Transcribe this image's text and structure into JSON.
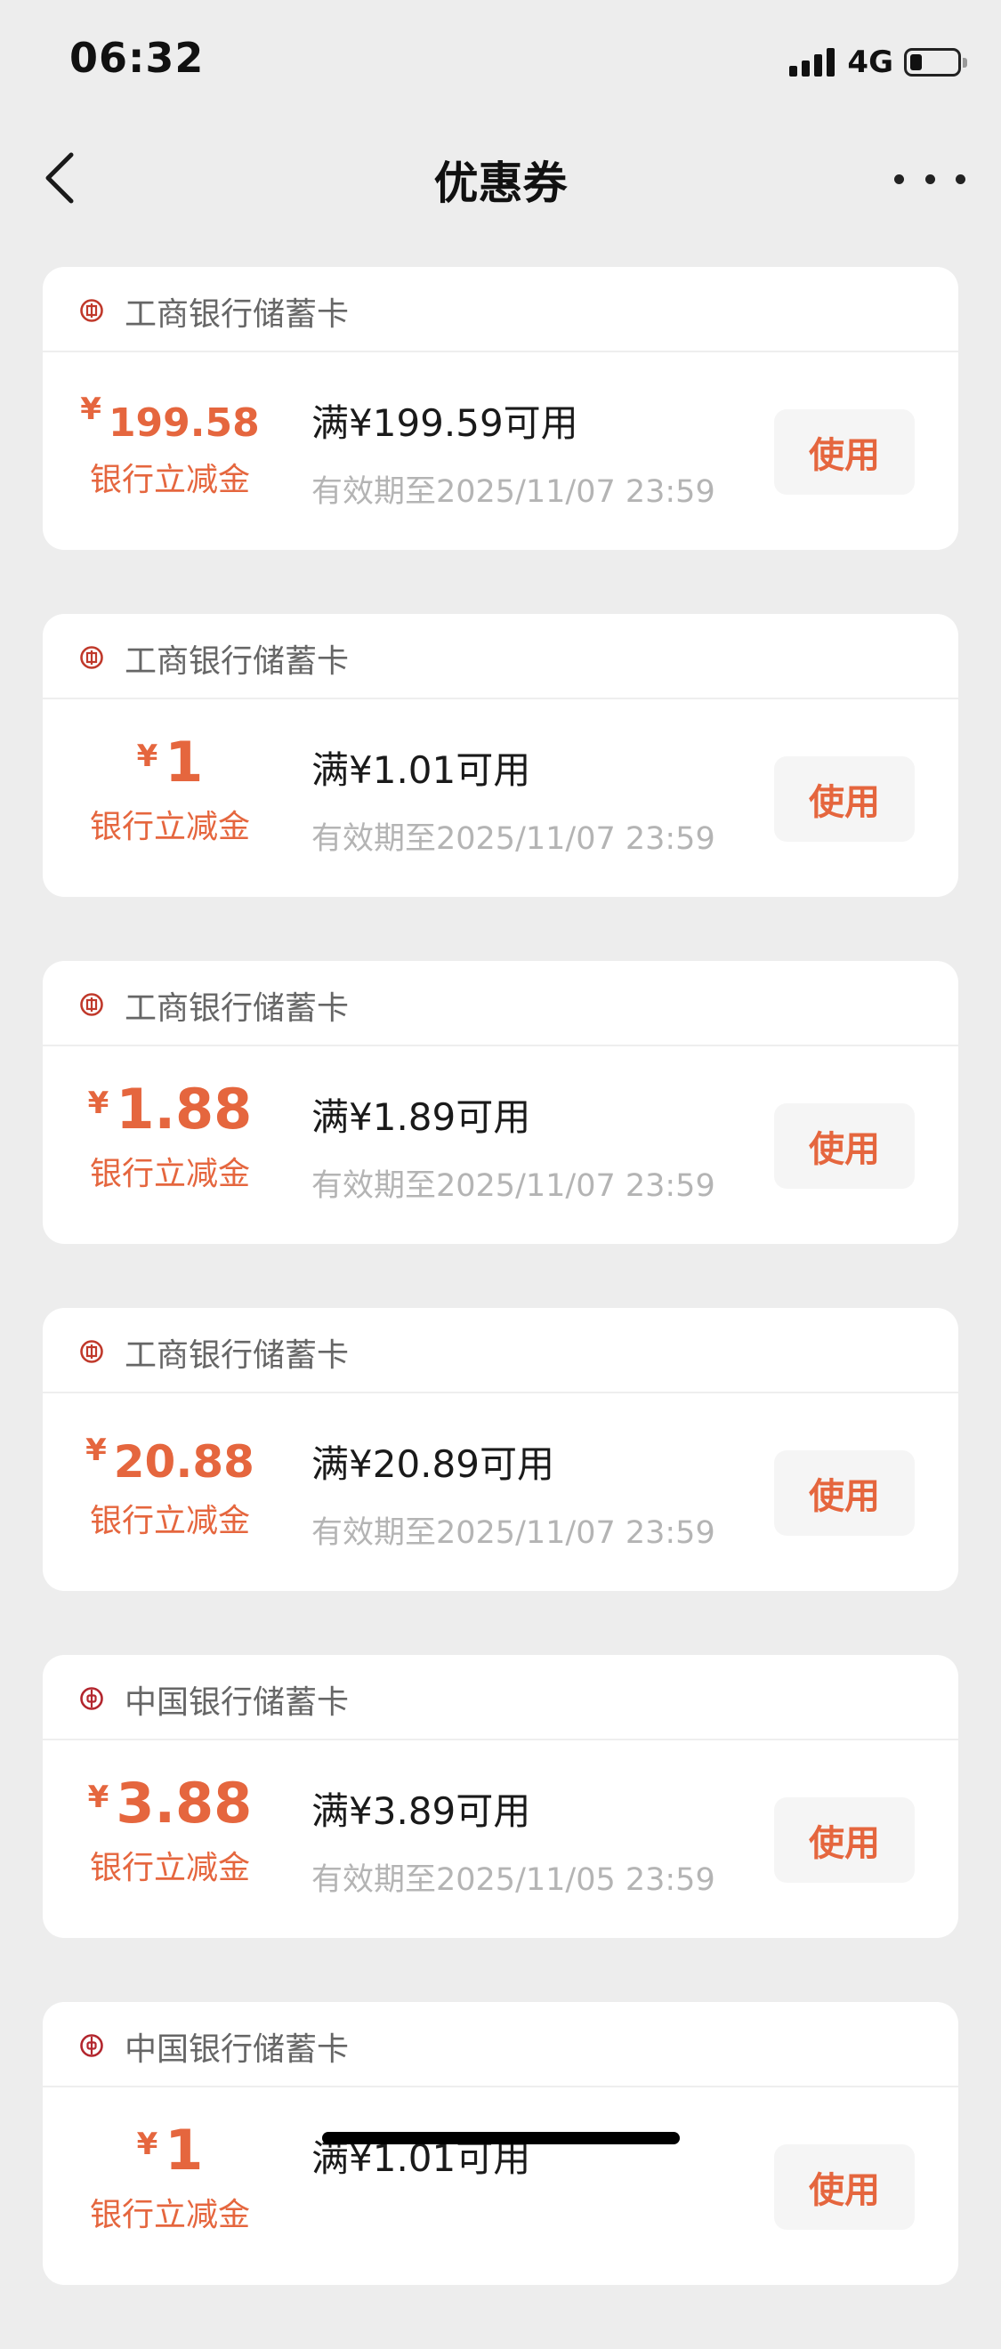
{
  "status_bar": {
    "time": "06:32",
    "network": "4G",
    "battery_level": 0.25
  },
  "header": {
    "title": "优惠券"
  },
  "coupons": [
    {
      "bank": "工商银行储蓄卡",
      "bank_icon": "icbc-logo-icon",
      "currency": "¥",
      "amount": "199.58",
      "amount_label": "银行立减金",
      "condition": "满¥199.59可用",
      "expiry": "有效期至2025/11/07 23:59",
      "button": "使用"
    },
    {
      "bank": "工商银行储蓄卡",
      "bank_icon": "icbc-logo-icon",
      "currency": "¥",
      "amount": "1",
      "amount_label": "银行立减金",
      "condition": "满¥1.01可用",
      "expiry": "有效期至2025/11/07 23:59",
      "button": "使用"
    },
    {
      "bank": "工商银行储蓄卡",
      "bank_icon": "icbc-logo-icon",
      "currency": "¥",
      "amount": "1.88",
      "amount_label": "银行立减金",
      "condition": "满¥1.89可用",
      "expiry": "有效期至2025/11/07 23:59",
      "button": "使用"
    },
    {
      "bank": "工商银行储蓄卡",
      "bank_icon": "icbc-logo-icon",
      "currency": "¥",
      "amount": "20.88",
      "amount_label": "银行立减金",
      "condition": "满¥20.89可用",
      "expiry": "有效期至2025/11/07 23:59",
      "button": "使用"
    },
    {
      "bank": "中国银行储蓄卡",
      "bank_icon": "boc-logo-icon",
      "currency": "¥",
      "amount": "3.88",
      "amount_label": "银行立减金",
      "condition": "满¥3.89可用",
      "expiry": "有效期至2025/11/05 23:59",
      "button": "使用"
    },
    {
      "bank": "中国银行储蓄卡",
      "bank_icon": "boc-logo-icon",
      "currency": "¥",
      "amount": "1",
      "amount_label": "银行立减金",
      "condition": "满¥1.01可用",
      "expiry": "",
      "button": "使用"
    }
  ],
  "colors": {
    "accent": "#e5663e",
    "page_bg": "#ededed",
    "card_bg": "#ffffff",
    "muted_text": "#b4b4b4",
    "icbc_red": "#c0392b",
    "boc_red": "#b3262e"
  }
}
